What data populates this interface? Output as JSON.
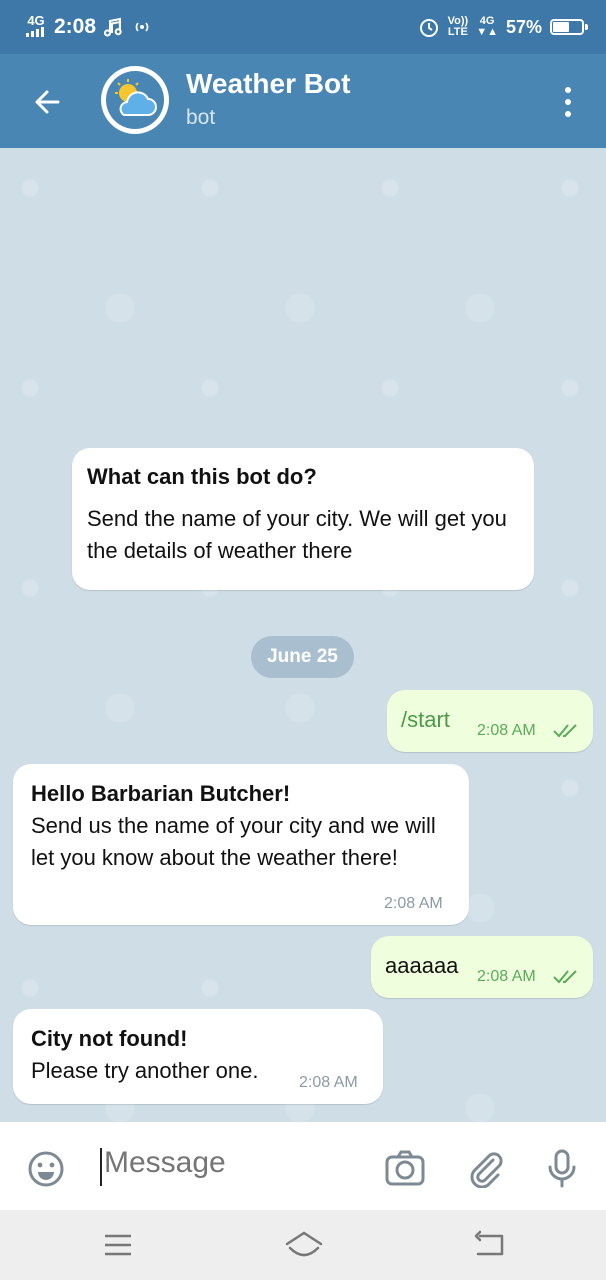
{
  "status_bar": {
    "network": "4G",
    "time": "2:08",
    "volte": "Vo))",
    "lte": "LTE",
    "network2": "4G",
    "battery_pct": "57%",
    "battery_level": 0.57
  },
  "header": {
    "title": "Weather Bot",
    "subtitle": "bot"
  },
  "chat": {
    "info_card": {
      "title": "What can this bot do?",
      "text": "Send the name of your city. We will get you the details of weather there"
    },
    "date_label": "June 25",
    "messages": [
      {
        "direction": "out",
        "text": "/start",
        "time": "2:08 AM"
      },
      {
        "direction": "in",
        "title": "Hello Barbarian Butcher!",
        "text": "Send us the name of your city and we will let you know about the weather there!",
        "time": "2:08 AM"
      },
      {
        "direction": "out",
        "text": "aaaaaa",
        "time": "2:08 AM"
      },
      {
        "direction": "in",
        "title": "City not found!",
        "text": "Please try another one.",
        "time": "2:08 AM"
      }
    ]
  },
  "input": {
    "placeholder": "Message"
  },
  "colors": {
    "header": "#4a86b4",
    "status_bar": "#3d78a8",
    "outgoing_bubble": "#effedd",
    "chat_background": "#cfdde6"
  }
}
